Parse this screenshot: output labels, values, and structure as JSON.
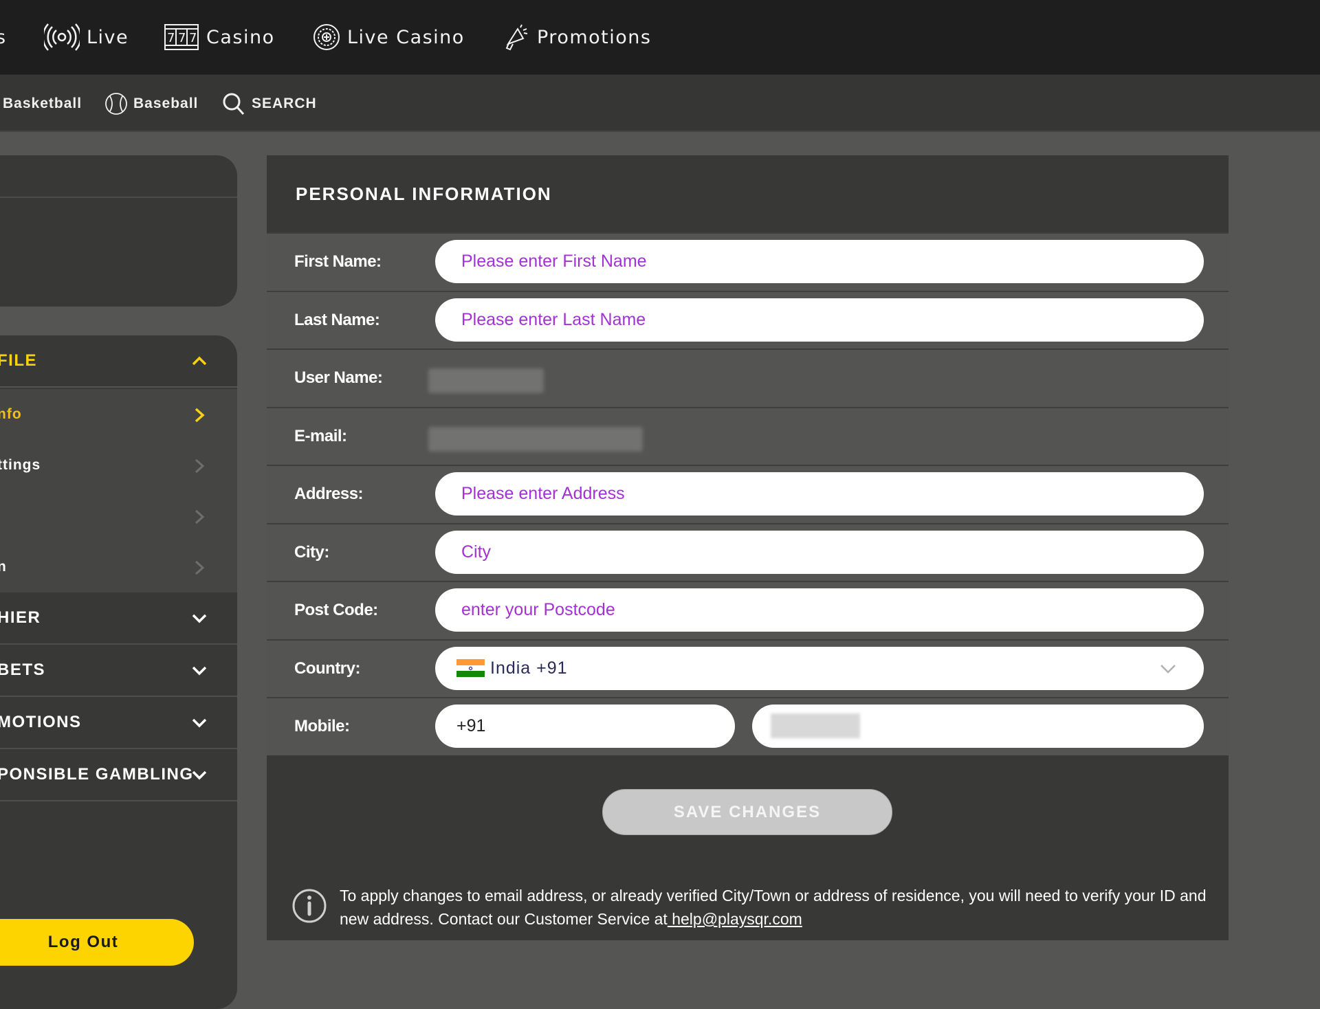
{
  "top_nav": {
    "items": [
      {
        "label": "s",
        "icon": "partial"
      },
      {
        "label": "Live",
        "icon": "broadcast-icon"
      },
      {
        "label": "Casino",
        "icon": "slot-777-icon"
      },
      {
        "label": "Live Casino",
        "icon": "roulette-icon"
      },
      {
        "label": "Promotions",
        "icon": "megaphone-icon"
      }
    ]
  },
  "sub_nav": {
    "items": [
      {
        "label": "Basketball"
      },
      {
        "label": "Baseball",
        "icon": "baseball-icon"
      },
      {
        "label": "SEARCH",
        "icon": "search-icon"
      }
    ]
  },
  "sidebar": {
    "sections": [
      {
        "label": "FILE",
        "expanded": true
      },
      {
        "label": "HIER",
        "expanded": false
      },
      {
        "label": "BETS",
        "expanded": false
      },
      {
        "label": "MOTIONS",
        "expanded": false
      },
      {
        "label": "PONSIBLE GAMBLING",
        "expanded": false
      }
    ],
    "profile_items": [
      {
        "label": "nfo",
        "active": true
      },
      {
        "label": "ttings",
        "active": false
      },
      {
        "label": "",
        "active": false
      },
      {
        "label": "n",
        "active": false
      }
    ],
    "logout_label": "Log Out"
  },
  "form": {
    "title": "PERSONAL INFORMATION",
    "fields": {
      "first_name": {
        "label": "First Name:",
        "placeholder": "Please enter First Name",
        "value": ""
      },
      "last_name": {
        "label": "Last Name:",
        "placeholder": "Please enter Last Name",
        "value": ""
      },
      "user_name": {
        "label": "User Name:",
        "value": "[redacted]"
      },
      "email": {
        "label": "E-mail:",
        "value": "[redacted]"
      },
      "address": {
        "label": "Address:",
        "placeholder": "Please enter Address",
        "value": ""
      },
      "city": {
        "label": "City:",
        "placeholder": "City",
        "value": ""
      },
      "post_code": {
        "label": "Post Code:",
        "placeholder": "enter your Postcode",
        "value": ""
      },
      "country": {
        "label": "Country:",
        "selected": "India +91"
      },
      "mobile": {
        "label": "Mobile:",
        "code": "+91",
        "number": "[redacted]"
      }
    },
    "save_label": "SAVE CHANGES",
    "info_text_1": " To apply changes to email address, or already verified City/Town or address of residence, you will need to verify your ID and new address. Contact our Customer Service at",
    "info_link": " help@playsqr.com"
  },
  "colors": {
    "accent": "#fdd400",
    "placeholder": "#a431d4",
    "topbar": "#1e1e1e",
    "panel": "#383836",
    "row": "#545452"
  }
}
